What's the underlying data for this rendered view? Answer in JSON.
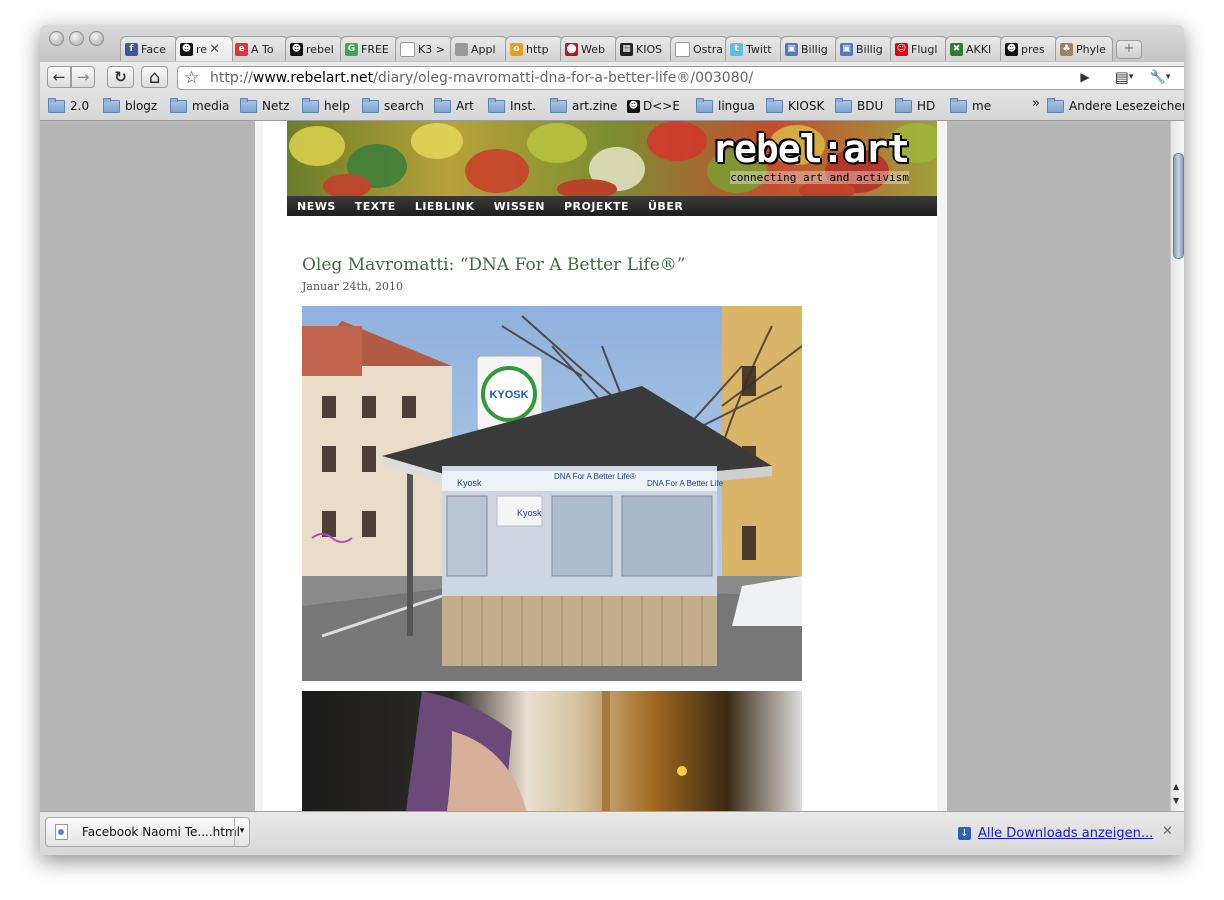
{
  "tabs": [
    {
      "label": "Face",
      "icon": "facebook-icon",
      "color": "#3b5998",
      "glyph": "f"
    },
    {
      "label": "re",
      "icon": "rebelart-icon",
      "color": "#111111",
      "glyph": "☻",
      "active": true,
      "close": "✕"
    },
    {
      "label": "A To",
      "icon": "ebay-icon",
      "color": "#e53238",
      "glyph": "e"
    },
    {
      "label": "rebel",
      "icon": "rebelart-icon",
      "color": "#111111",
      "glyph": "☻"
    },
    {
      "label": "FREE",
      "icon": "google-icon",
      "color": "#34a853",
      "glyph": "G"
    },
    {
      "label": "K3 >",
      "icon": "page-icon",
      "color": "#ffffff",
      "glyph": ""
    },
    {
      "label": "Appl",
      "icon": "apple-icon",
      "color": "#9a9a9a",
      "glyph": ""
    },
    {
      "label": "http",
      "icon": "orange-circle-icon",
      "color": "#e8a020",
      "glyph": "o"
    },
    {
      "label": "Web",
      "icon": "web-icon",
      "color": "#c0102a",
      "glyph": "⬤"
    },
    {
      "label": "KIOS",
      "icon": "kiosk-icon",
      "color": "#222222",
      "glyph": "▦"
    },
    {
      "label": "Ostra",
      "icon": "page-icon",
      "color": "#ffffff",
      "glyph": ""
    },
    {
      "label": "Twitt",
      "icon": "twitter-icon",
      "color": "#5bc0de",
      "glyph": "t"
    },
    {
      "label": "Billig",
      "icon": "cube-icon",
      "color": "#5577bb",
      "glyph": "▣"
    },
    {
      "label": "Billig",
      "icon": "cube-icon",
      "color": "#5577bb",
      "glyph": "▣"
    },
    {
      "label": "Flugl",
      "icon": "tui-icon",
      "color": "#e3000f",
      "glyph": "☺"
    },
    {
      "label": "AKKI",
      "icon": "akki-icon",
      "color": "#2e7d32",
      "glyph": "✖"
    },
    {
      "label": "pres",
      "icon": "rebelart-icon",
      "color": "#111111",
      "glyph": "☻"
    },
    {
      "label": "Phyle",
      "icon": "tree-icon",
      "color": "#a08060",
      "glyph": "♣"
    }
  ],
  "toolbar": {
    "back": "←",
    "forward": "→",
    "reload": "↻",
    "home": "⌂",
    "star": "☆",
    "go": "▶",
    "page_menu": "▤",
    "wrench": "🔧",
    "url_prefix": "http://",
    "url_domain": "www.rebelart.net",
    "url_path": "/diary/oleg-mavromatti-dna-for-a-better-life®/003080/"
  },
  "bookmarks": [
    {
      "label": "2.0",
      "icon": "folder-icon"
    },
    {
      "label": "blogz",
      "icon": "folder-icon"
    },
    {
      "label": "media",
      "icon": "folder-icon"
    },
    {
      "label": "Netz",
      "icon": "folder-icon"
    },
    {
      "label": "help",
      "icon": "folder-icon"
    },
    {
      "label": "search",
      "icon": "folder-icon"
    },
    {
      "label": "Art",
      "icon": "folder-icon"
    },
    {
      "label": "Inst.",
      "icon": "folder-icon"
    },
    {
      "label": "art.zine",
      "icon": "folder-icon"
    },
    {
      "label": "D<>E",
      "icon": "rebelart-icon"
    },
    {
      "label": "lingua",
      "icon": "folder-icon"
    },
    {
      "label": "KIOSK",
      "icon": "folder-icon"
    },
    {
      "label": "BDU",
      "icon": "folder-icon"
    },
    {
      "label": "HD",
      "icon": "folder-icon"
    },
    {
      "label": "me",
      "icon": "folder-icon"
    }
  ],
  "bookmarks_overflow": "»",
  "other_bookmarks": "Andere Lesezeichen",
  "site": {
    "logo": "rebel:art",
    "tagline": "connecting art and activism",
    "nav": [
      "NEWS",
      "TEXTE",
      "LIEBLINK",
      "WISSEN",
      "PROJEKTE",
      "ÜBER"
    ]
  },
  "post": {
    "title": "Oleg Mavromatti: “DNA For A Better Life®”",
    "date": "Januar 24th, 2010",
    "kiosk_sign": "KYOSK",
    "kiosk_brand": "Kyosk",
    "kiosk_banner_left": "Kyosk",
    "kiosk_banner_mid": "DNA For A Better Life®",
    "kiosk_banner_right": "DNA For A Better Life"
  },
  "downloads": {
    "item_name": "Facebook  Naomi Te....html",
    "dropdown": "▾",
    "show_all": "Alle Downloads anzeigen...",
    "close": "✕"
  },
  "colors": {
    "title_green": "#3d6b41",
    "link_blue": "#1a1ac8",
    "nav_bg": "#1f1f1f"
  }
}
